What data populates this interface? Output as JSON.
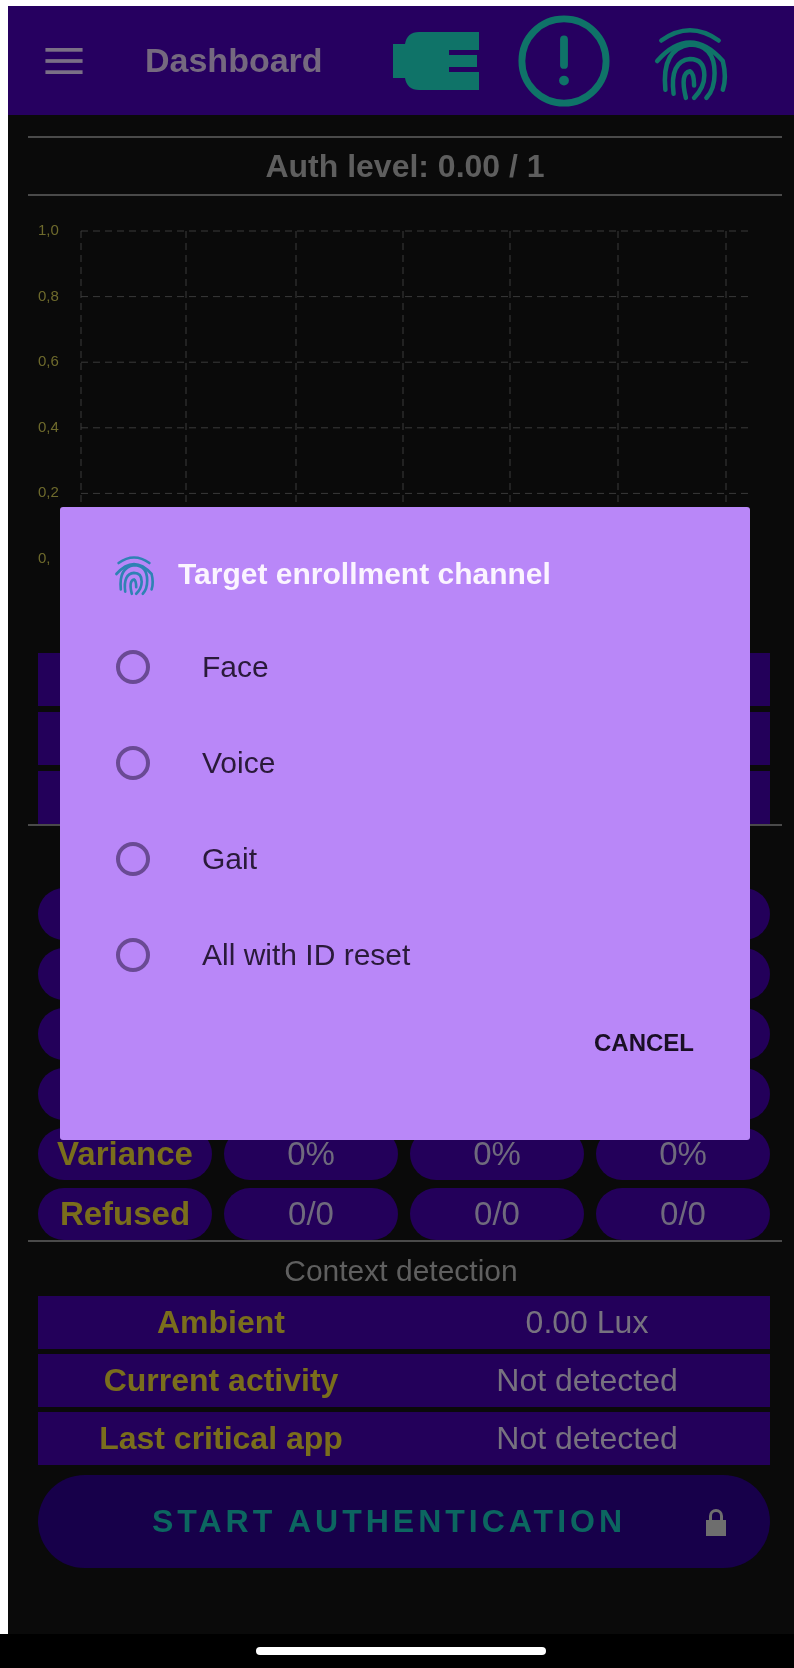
{
  "app_bar": {
    "title": "Dashboard"
  },
  "auth_level": "Auth level: 0.00 / 1",
  "chart": {
    "y_axis_labels": [
      "1,0",
      "0,8",
      "0,6",
      "0,4",
      "0,2",
      "0,"
    ]
  },
  "stats": [
    {
      "label": "Variance",
      "values": [
        "0%",
        "0%",
        "0%"
      ]
    },
    {
      "label": "Refused",
      "values": [
        "0/0",
        "0/0",
        "0/0"
      ]
    }
  ],
  "context": {
    "title": "Context detection",
    "rows": [
      {
        "label": "Ambient",
        "value": "0.00 Lux"
      },
      {
        "label": "Current activity",
        "value": "Not detected"
      },
      {
        "label": "Last critical app",
        "value": "Not detected"
      }
    ]
  },
  "start_button": {
    "label": "START AUTHENTICATION"
  },
  "dialog": {
    "title": "Target enrollment channel",
    "options": [
      {
        "label": "Face",
        "selected": false
      },
      {
        "label": "Voice",
        "selected": false
      },
      {
        "label": "Gait",
        "selected": false
      },
      {
        "label": "All with ID reset",
        "selected": false
      }
    ],
    "cancel": "CANCEL"
  }
}
